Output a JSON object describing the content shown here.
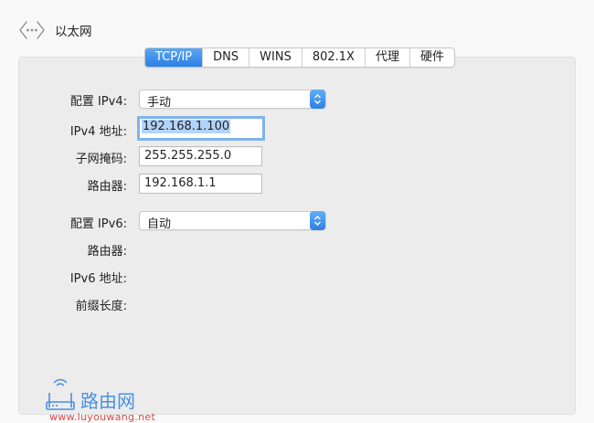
{
  "header": {
    "title": "以太网",
    "icon": "network-back-icon"
  },
  "tabs": [
    {
      "label": "TCP/IP",
      "active": true
    },
    {
      "label": "DNS",
      "active": false
    },
    {
      "label": "WINS",
      "active": false
    },
    {
      "label": "802.1X",
      "active": false
    },
    {
      "label": "代理",
      "active": false
    },
    {
      "label": "硬件",
      "active": false
    }
  ],
  "ipv4": {
    "config_label": "配置 IPv4:",
    "config_value": "手动",
    "address_label": "IPv4 地址:",
    "address_value": "192.168.1.100",
    "subnet_label": "子网掩码:",
    "subnet_value": "255.255.255.0",
    "router_label": "路由器:",
    "router_value": "192.168.1.1"
  },
  "ipv6": {
    "config_label": "配置 IPv6:",
    "config_value": "自动",
    "router_label": "路由器:",
    "address_label": "IPv6 地址:",
    "prefix_label": "前缀长度:"
  },
  "watermark": {
    "brand": "路由网",
    "url": "www.luyouwang.net"
  },
  "colors": {
    "accent": "#2f7fe6",
    "focus_ring": "#7fb3ea",
    "panel_bg": "#ececec",
    "watermark_blue": "#4a90e2",
    "watermark_red": "#e04848"
  }
}
